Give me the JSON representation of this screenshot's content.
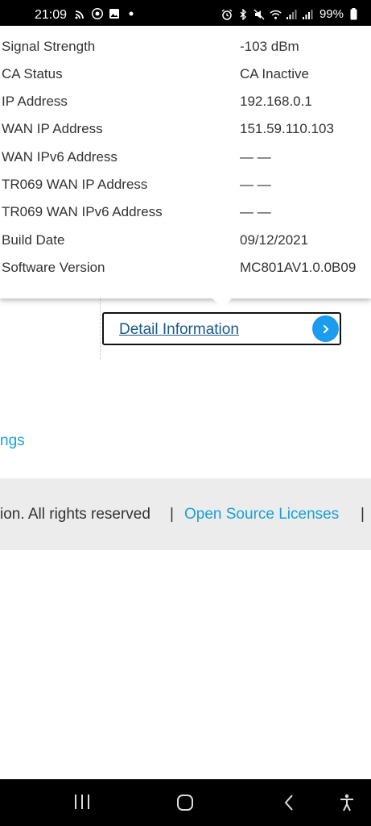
{
  "status_bar": {
    "time": "21:09",
    "left_icons": [
      "cast-icon",
      "chrome-icon",
      "gallery-icon",
      "dot-icon"
    ],
    "right_icons": [
      "alarm-icon",
      "bluetooth-icon",
      "mute-icon",
      "wifi-icon",
      "signal-icon",
      "signal-icon"
    ],
    "battery": "99%"
  },
  "details": {
    "rows": [
      {
        "label": "Signal Strength",
        "value": "-103 dBm"
      },
      {
        "label": "CA Status",
        "value": "CA Inactive"
      },
      {
        "label": "IP Address",
        "value": "192.168.0.1"
      },
      {
        "label": "WAN IP Address",
        "value": "151.59.110.103"
      },
      {
        "label": "WAN IPv6 Address",
        "value": "— —"
      },
      {
        "label": "TR069 WAN IP Address",
        "value": "— —"
      },
      {
        "label": "TR069 WAN IPv6 Address",
        "value": "— —"
      },
      {
        "label": "Build Date",
        "value": "09/12/2021"
      },
      {
        "label": "Software Version",
        "value": "MC801AV1.0.0B09"
      }
    ]
  },
  "main": {
    "detail_button_label": "Detail Information",
    "settings_link": "ngs"
  },
  "footer": {
    "rights_text": "ion. All rights reserved",
    "separator": "|",
    "open_source_link": "Open Source Licenses"
  },
  "colors": {
    "link": "#1aa0d8",
    "detail_link": "#1b5a87",
    "circle_button": "#1c9cef"
  }
}
